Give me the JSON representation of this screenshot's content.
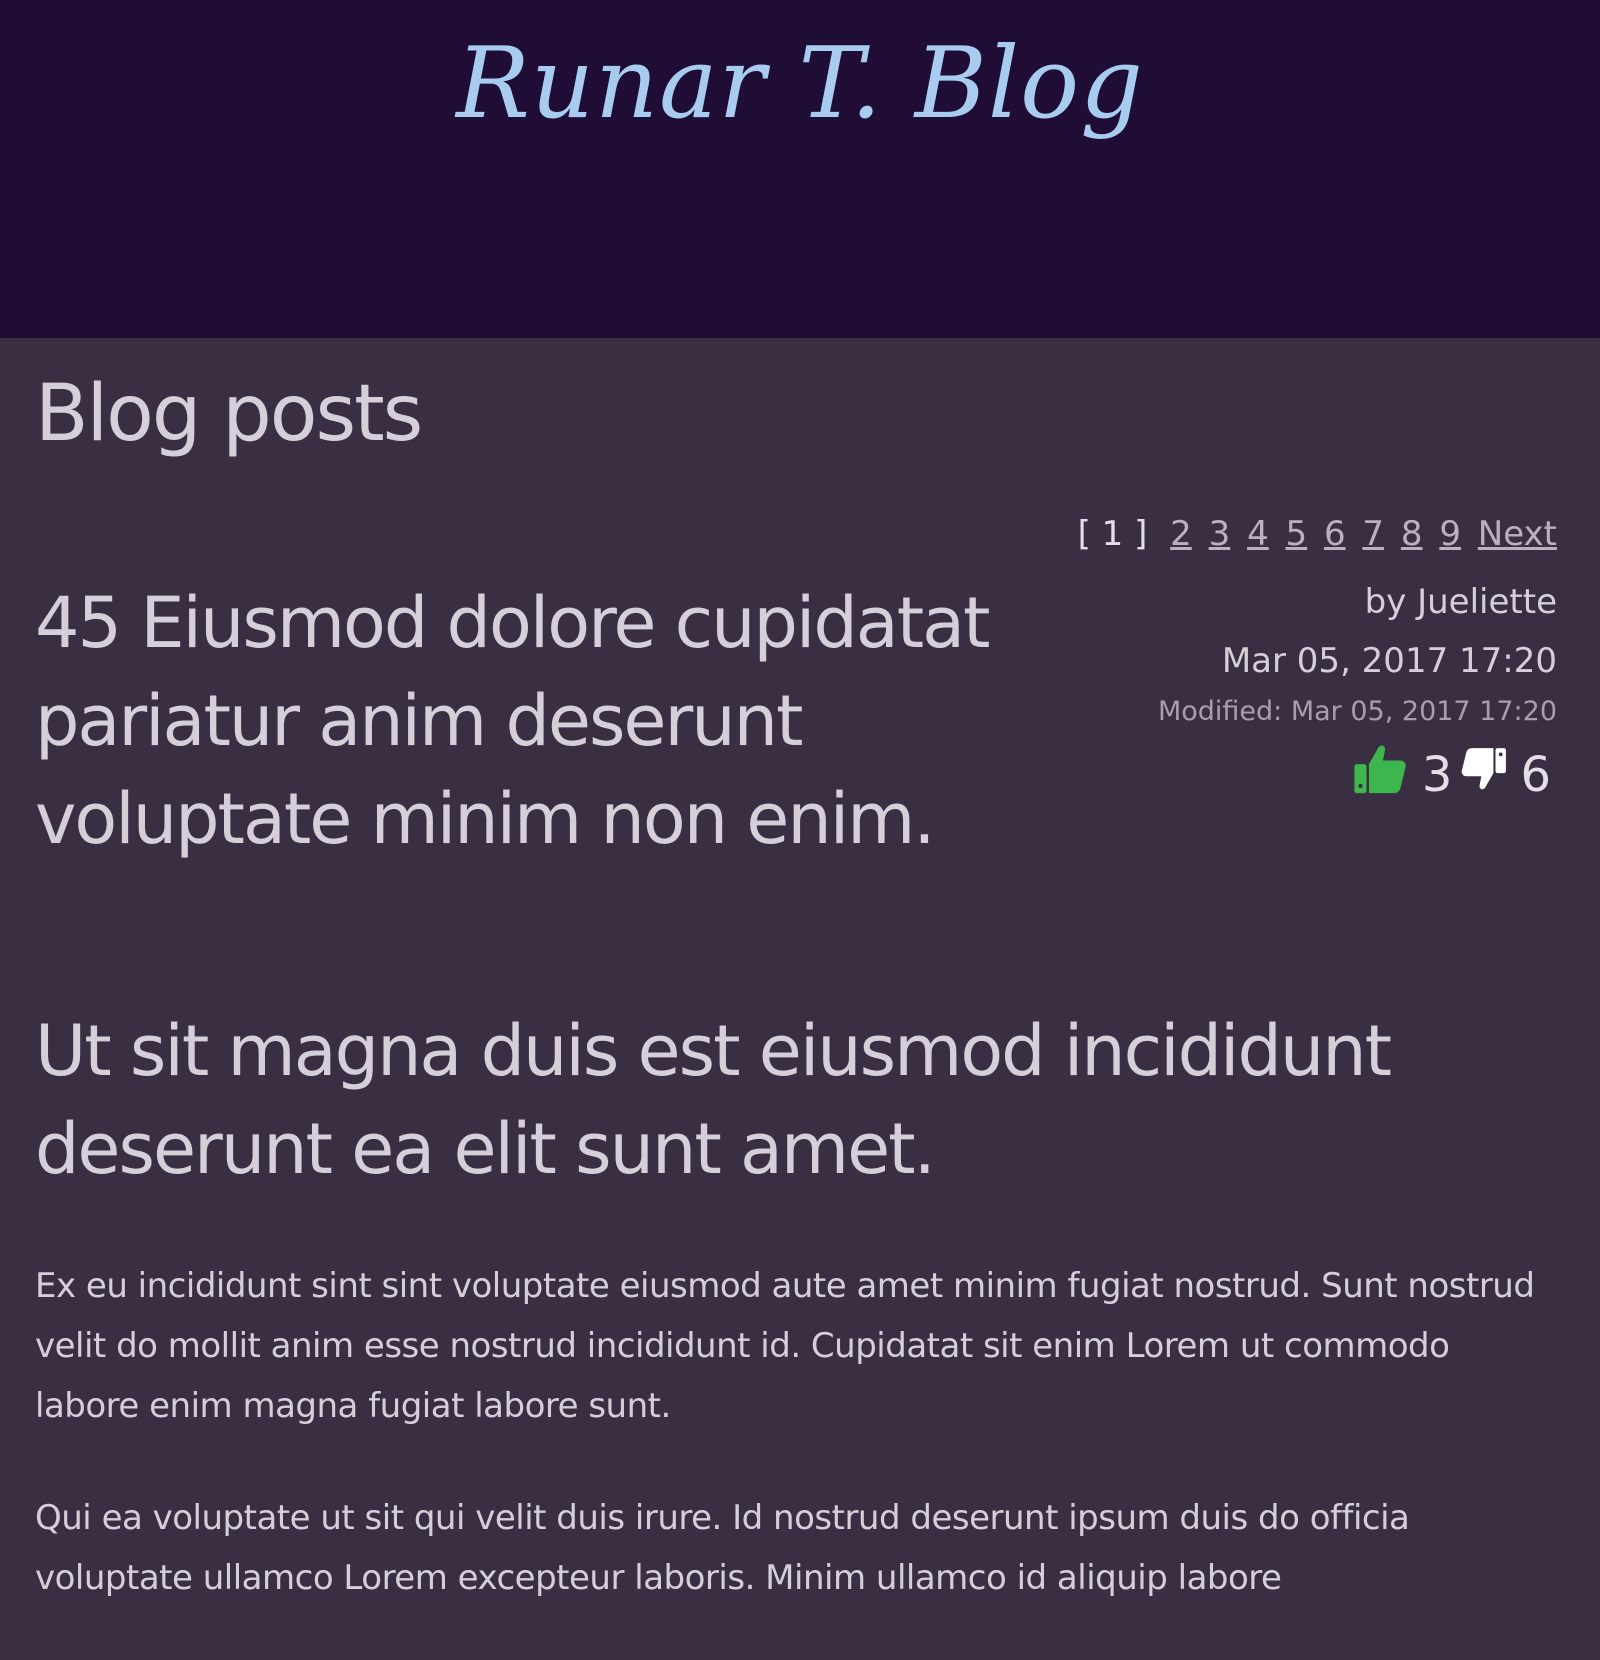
{
  "header": {
    "site_title": "Runar T. Blog"
  },
  "main": {
    "page_heading": "Blog posts",
    "pagination": {
      "current": "[ 1 ]",
      "pages": [
        "2",
        "3",
        "4",
        "5",
        "6",
        "7",
        "8",
        "9"
      ],
      "next_label": "Next"
    },
    "post": {
      "title": "45 Eiusmod dolore cupidatat pariatur anim deserunt voluptate minim non enim.",
      "author": "by Jueliette",
      "date": "Mar 05, 2017 17:20",
      "modified": "Modified: Mar 05, 2017 17:20",
      "likes": "3",
      "dislikes": "6",
      "like_color": "#3db64e",
      "dislike_color": "#ffffff",
      "subtitle": "Ut sit magna duis est eiusmod incididunt deserunt ea elit sunt amet.",
      "paragraphs": [
        "Ex eu incididunt sint sint voluptate eiusmod aute amet minim fugiat nostrud. Sunt nostrud velit do mollit anim esse nostrud incididunt id. Cupidatat sit enim Lorem ut commodo labore enim magna fugiat labore sunt.",
        "Qui ea voluptate ut sit qui velit duis irure. Id nostrud deserunt ipsum duis do officia voluptate ullamco Lorem excepteur laboris. Minim ullamco id aliquip labore"
      ]
    }
  },
  "icons": {
    "like": "thumbs-up-icon",
    "dislike": "thumbs-down-icon"
  }
}
